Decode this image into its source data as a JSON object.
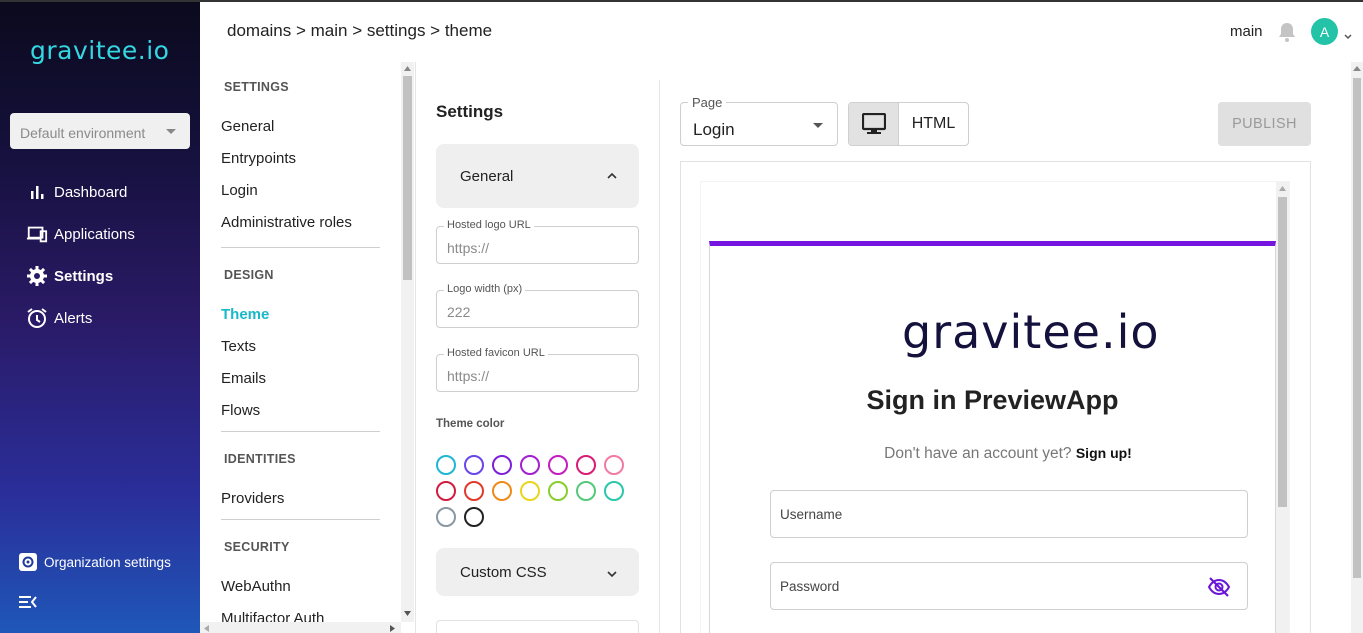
{
  "brand": {
    "logo_text": "gravitee.io",
    "accent": "#19b9c9"
  },
  "nav": {
    "environment": "Default environment",
    "items": [
      {
        "label": "Dashboard",
        "icon": "bar-chart-icon",
        "active": false
      },
      {
        "label": "Applications",
        "icon": "devices-icon",
        "active": false
      },
      {
        "label": "Settings",
        "icon": "gear-icon",
        "active": true
      },
      {
        "label": "Alerts",
        "icon": "alarm-clock-icon",
        "active": false
      }
    ],
    "org_settings": "Organization settings"
  },
  "header": {
    "breadcrumb": "domains > main > settings > theme",
    "domain": "main",
    "avatar_initial": "A"
  },
  "subnav": {
    "sections": [
      {
        "title": "SETTINGS",
        "items": [
          "General",
          "Entrypoints",
          "Login",
          "Administrative roles"
        ]
      },
      {
        "title": "DESIGN",
        "items": [
          "Theme",
          "Texts",
          "Emails",
          "Flows"
        ]
      },
      {
        "title": "IDENTITIES",
        "items": [
          "Providers"
        ]
      },
      {
        "title": "SECURITY",
        "items": [
          "WebAuthn",
          "Multifactor Auth"
        ]
      }
    ],
    "active_item": "Theme"
  },
  "settings_form": {
    "title": "Settings",
    "general_panel": "General",
    "fields": [
      {
        "label": "Hosted logo URL",
        "placeholder": "https://",
        "value": ""
      },
      {
        "label": "Logo width (px)",
        "placeholder": "",
        "value": "222"
      },
      {
        "label": "Hosted favicon URL",
        "placeholder": "https://",
        "value": ""
      }
    ],
    "theme_color_label": "Theme color",
    "theme_colors": [
      "#1fb6d2",
      "#6a45e8",
      "#7d1fd8",
      "#a21fd2",
      "#c51cc1",
      "#d81b76",
      "#f07aa3",
      "#d21c3f",
      "#e03a2a",
      "#ef8a17",
      "#e9d51d",
      "#86cf2c",
      "#54c97a",
      "#2ac7a8",
      "#8a98a3",
      "#222222"
    ],
    "custom_css_panel": "Custom CSS"
  },
  "preview": {
    "page_label": "Page",
    "page_value": "Login",
    "html_toggle": "HTML",
    "publish": "PUBLISH",
    "logo_text": "gravitee.io",
    "title": "Sign in PreviewApp",
    "signup_prompt": "Don't have an account yet?",
    "signup_link": "Sign up!",
    "username_placeholder": "Username",
    "password_placeholder": "Password",
    "card_accent": "#7715e0"
  }
}
